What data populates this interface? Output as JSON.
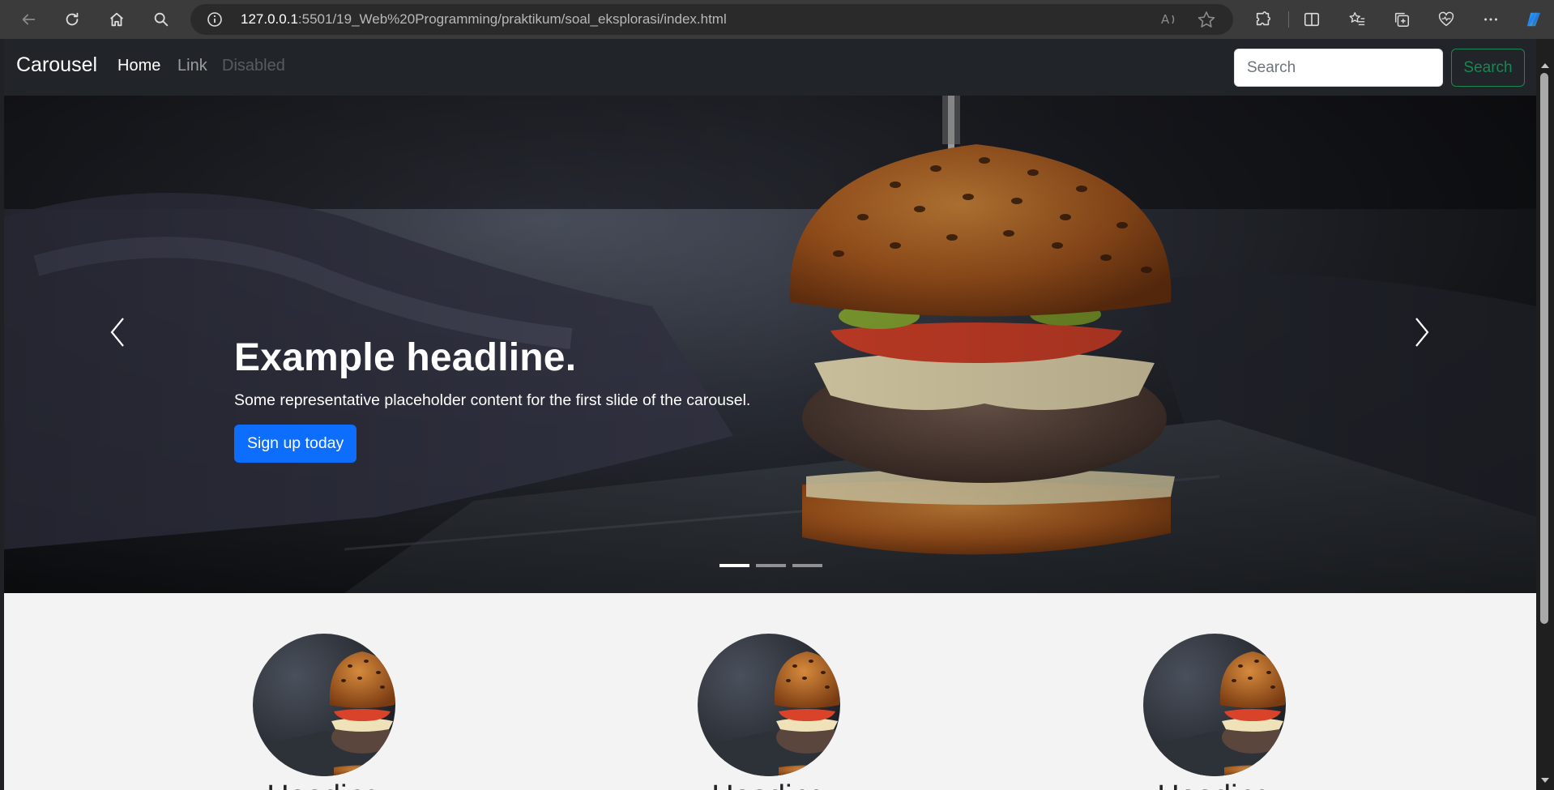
{
  "browser": {
    "url_host": "127.0.0.1",
    "url_path": ":5501/19_Web%20Programming/praktikum/soal_eksplorasi/index.html"
  },
  "navbar": {
    "brand": "Carousel",
    "links": [
      "Home",
      "Link",
      "Disabled"
    ],
    "search_placeholder": "Search",
    "search_button": "Search"
  },
  "carousel": {
    "headline": "Example headline.",
    "text": "Some representative placeholder content for the first slide of the carousel.",
    "button": "Sign up today",
    "slide_count": 3,
    "active_slide": 1
  },
  "marketing": {
    "headings": [
      "Heading",
      "Heading",
      "Heading"
    ]
  },
  "colors": {
    "navbar_bg": "#212529",
    "primary": "#0d6efd",
    "success": "#198754",
    "page_bg": "#f3f3f3"
  }
}
